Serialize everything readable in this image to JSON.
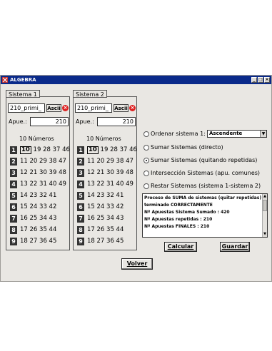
{
  "window": {
    "title": "ALGEBRA",
    "icon": "algebra-app-icon",
    "controls": {
      "minimize": "_",
      "maximize": "□",
      "close": "×"
    }
  },
  "sistema1": {
    "label": "Sistema 1",
    "file": "210_primi_",
    "ascii_label": "Ascii",
    "apue_label": "Apue.:",
    "apue_value": "210",
    "numbers_title": "10 Números",
    "rows": [
      {
        "idx": "1",
        "first": "10",
        "rest": "19 28 37 46"
      },
      {
        "idx": "2",
        "first": "",
        "rest": "11 20 29 38 47"
      },
      {
        "idx": "3",
        "first": "",
        "rest": "12 21 30 39 48"
      },
      {
        "idx": "4",
        "first": "",
        "rest": "13 22 31 40 49"
      },
      {
        "idx": "5",
        "first": "",
        "rest": "14 23 32 41"
      },
      {
        "idx": "6",
        "first": "",
        "rest": "15 24 33 42"
      },
      {
        "idx": "7",
        "first": "",
        "rest": "16 25 34 43"
      },
      {
        "idx": "8",
        "first": "",
        "rest": "17 26 35 44"
      },
      {
        "idx": "9",
        "first": "",
        "rest": "18 27 36 45"
      }
    ]
  },
  "sistema2": {
    "label": "Sistema 2",
    "file": "210_primi_",
    "ascii_label": "Ascii",
    "apue_label": "Apue.:",
    "apue_value": "210",
    "numbers_title": "10 Números",
    "rows": [
      {
        "idx": "1",
        "first": "10",
        "rest": "19 28 37 46"
      },
      {
        "idx": "2",
        "first": "",
        "rest": "11 20 29 38 47"
      },
      {
        "idx": "3",
        "first": "",
        "rest": "12 21 30 39 48"
      },
      {
        "idx": "4",
        "first": "",
        "rest": "13 22 31 40 49"
      },
      {
        "idx": "5",
        "first": "",
        "rest": "14 23 32 41"
      },
      {
        "idx": "6",
        "first": "",
        "rest": "15 24 33 42"
      },
      {
        "idx": "7",
        "first": "",
        "rest": "16 25 34 43"
      },
      {
        "idx": "8",
        "first": "",
        "rest": "17 26 35 44"
      },
      {
        "idx": "9",
        "first": "",
        "rest": "18 27 36 45"
      }
    ]
  },
  "options": {
    "ordenar_label": "Ordenar sistema 1:",
    "ordenar_value": "Ascendente",
    "sumar_directo": "Sumar Sistemas (directo)",
    "sumar_quitando": "Sumar Sistemas (quitando repetidas)",
    "interseccion": "Intersección Sistemas (apu. comunes)",
    "restar": "Restar Sistemas (sistema 1-sistema 2)",
    "selected": "sumar_quitando"
  },
  "output": {
    "lines": [
      "Proceso de SUMA de sistemas (quitar repetidas)",
      "terminado CORRECTAMENTE",
      "Nº Apuestas Sistema Sumado : 420",
      "Nº Apuestas repetidas : 210",
      "Nº Apuestas FINALES : 210"
    ]
  },
  "buttons": {
    "calcular": "Calcular",
    "guardar": "Guardar",
    "volver": "Volver"
  },
  "colors": {
    "titlebar": "#0a2a8a",
    "window_bg": "#e9e7e3",
    "index_box": "#333333",
    "clear_icon": "#dd2222"
  }
}
